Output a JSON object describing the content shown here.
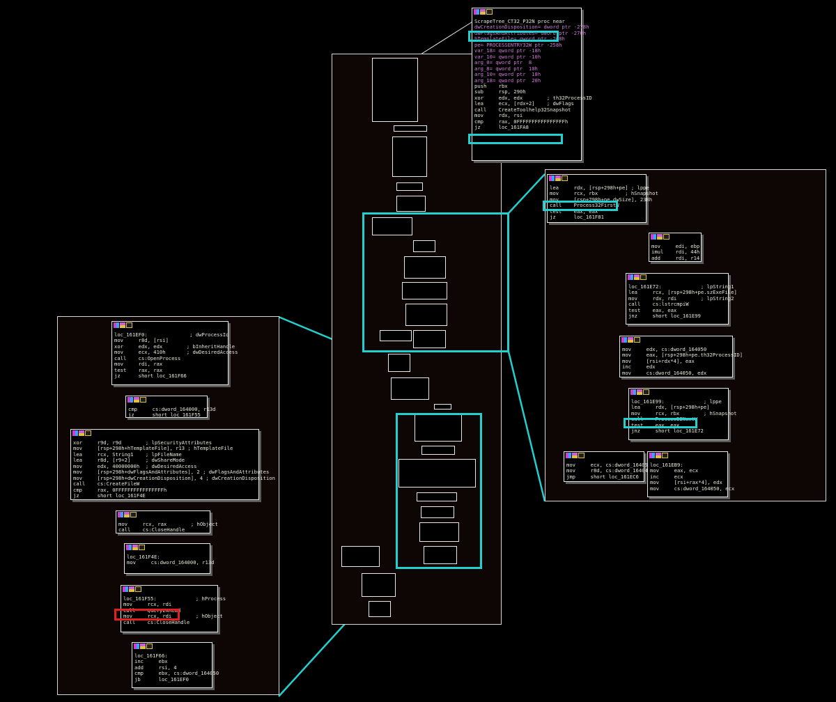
{
  "colors": {
    "highlight": "#22d0d0",
    "alert": "#e22020",
    "edge_true": "#e0d040",
    "edge_false": "#e070e0",
    "edge_flow": "#30c0e0"
  },
  "top_block": {
    "lines": [
      "ScrapeTree_CT32_P32N proc near",
      "",
      "dwCreationDisposition= dword ptr -278h",
      "dwFlagsAndAttributes= dword ptr -270h",
      "hTemplateFile= qword ptr -268h",
      "pe= PROCESSENTRY32W ptr -258h",
      "var_18= qword ptr -18h",
      "var_10= qword ptr -10h",
      "arg_0= qword ptr  8",
      "arg_8= qword ptr  10h",
      "arg_10= qword ptr  18h",
      "arg_18= qword ptr  20h",
      "",
      "push    rbx",
      "sub     rsp, 290h",
      "xor     edx, edx        ; th32ProcessID",
      "lea     ecx, [rdx+2]    ; dwFlags",
      "call    CreateToolhelp32Snapshot",
      "mov     rdx, rsi",
      "cmp     rax, 0FFFFFFFFFFFFFFFFh",
      "jz      loc_161FA8"
    ]
  },
  "right_blocks": {
    "b1": [
      "lea     rdx, [rsp+298h+pe] ; lppe",
      "mov     rcx, rbx         ; hSnapshot",
      "mov     [rsp+298h+pe.dwSize], 238h",
      "call    Process32FirstW",
      "test    eax, eax",
      "jz      loc_161F81"
    ],
    "b2": [
      "mov     edi, ebp",
      "imul    rdi, 44h",
      "add     rdi, r14"
    ],
    "b3": [
      "loc_161E72:             ; lpString1",
      "lea     rcx, [rsp+298h+pe.szExeFile]",
      "mov     rdx, rdi        ; lpString2",
      "call    cs:lstrcmpiW",
      "test    eax, eax",
      "jnz     short loc_161E99"
    ],
    "b4": [
      "mov     edx, cs:dword_164050",
      "mov     eax, [rsp+298h+pe.th32ProcessID]",
      "mov     [rsi+rdx*4], eax",
      "inc     edx",
      "mov     cs:dword_164050, edx"
    ],
    "b5": [
      "loc_161E99:             ; lppe",
      "lea     rdx, [rsp+298h+pe]",
      "mov     rcx, rbx        ; hSnapshot",
      "call    Process32NextW",
      "test    eax, eax",
      "jnz     short loc_161E72"
    ],
    "b6": [
      "mov     ecx, cs:dword_164050",
      "mov     r8d, cs:dword_16404C",
      "jmp     short loc_161EC6"
    ],
    "b7": [
      "loc_161EB9:",
      "mov     eax, ecx",
      "inc     ecx",
      "mov     [rsi+rax*4], edx",
      "mov     cs:dword_164050, ecx"
    ]
  },
  "left_blocks": {
    "b1": [
      "loc_161EF0:              ; dwProcessId",
      "mov     r8d, [rsi]",
      "xor     edx, edx        ; bInheritHandle",
      "mov     ecx, 410h       ; dwDesiredAccess",
      "call    cs:OpenProcess",
      "mov     rdi, rax",
      "test    rax, rax",
      "jz      short loc_161F66"
    ],
    "b2": [
      "cmp     cs:dword_164000, r13d",
      "jz      short loc_161F55"
    ],
    "b3": [
      "xor     r9d, r9d        ; lpSecurityAttributes",
      "mov     [rsp+298h+hTemplateFile], r13 ; hTemplateFile",
      "lea     rcx, String1    ; lpFileName",
      "lea     r8d, [r9+2]     ; dwShareMode",
      "mov     edx, 40000000h  ; dwDesiredAccess",
      "mov     [rsp+298h+dwFlagsAndAttributes], 2 ; dwFlagsAndAttributes",
      "mov     [rsp+298h+dwCreationDisposition], 4 ; dwCreationDisposition",
      "call    cs:CreateFileW",
      "cmp     rax, 0FFFFFFFFFFFFFFFFh",
      "jz      short loc_161F4E"
    ],
    "b4": [
      "mov     rcx, rax        ; hObject",
      "call    cs:CloseHandle"
    ],
    "b5": [
      "loc_161F4E:",
      "mov     cs:dword_164000, r13d"
    ],
    "b6": [
      "loc_161F55:             ; hProcess",
      "mov     rcx, rdi",
      "call    QueryExRead",
      "mov     rcx, rdi        ; hObject",
      "call    cs:CloseHandle"
    ],
    "b7": [
      "loc_161F66:",
      "inc     ebx",
      "add     rsi, 4",
      "cmp     ebx, cs:dword_164050",
      "jb      loc_161EF0"
    ]
  }
}
